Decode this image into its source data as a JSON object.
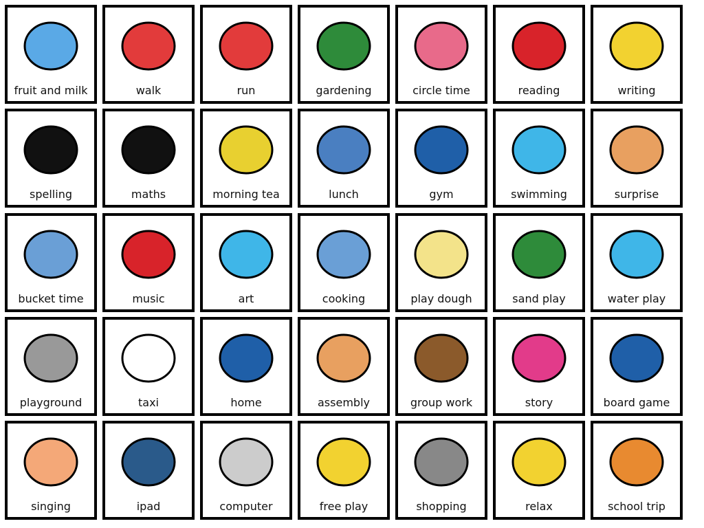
{
  "cards": [
    {
      "label": "fruit and milk",
      "icon": "milkshake-fruit-icon",
      "color": "#5aa9e6"
    },
    {
      "label": "walk",
      "icon": "walking-person-icon",
      "color": "#e23b3b"
    },
    {
      "label": "run",
      "icon": "running-person-icon",
      "color": "#e23b3b"
    },
    {
      "label": "gardening",
      "icon": "garden-tools-icon",
      "color": "#2e8b3a"
    },
    {
      "label": "circle time",
      "icon": "children-circle-icon",
      "color": "#e86a8a"
    },
    {
      "label": "reading",
      "icon": "reading-book-icon",
      "color": "#d8232a"
    },
    {
      "label": "writing",
      "icon": "writing-hand-icon",
      "color": "#f2d230"
    },
    {
      "label": "spelling",
      "icon": "abc-letters-icon",
      "color": "#111111"
    },
    {
      "label": "maths",
      "icon": "numbers-123-icon",
      "color": "#111111"
    },
    {
      "label": "morning tea",
      "icon": "sandwich-fruit-icon",
      "color": "#e8d030"
    },
    {
      "label": "lunch",
      "icon": "lunch-plate-icon",
      "color": "#4a7fc1"
    },
    {
      "label": "gym",
      "icon": "gym-equipment-icon",
      "color": "#1f5fa8"
    },
    {
      "label": "swimming",
      "icon": "swimmer-icon",
      "color": "#3fb6e8"
    },
    {
      "label": "surprise",
      "icon": "surprised-face-icon",
      "color": "#e8a060"
    },
    {
      "label": "bucket time",
      "icon": "bucket-icon",
      "color": "#6a9fd6"
    },
    {
      "label": "music",
      "icon": "instruments-icon",
      "color": "#d8232a"
    },
    {
      "label": "art",
      "icon": "art-supplies-icon",
      "color": "#3fb6e8"
    },
    {
      "label": "cooking",
      "icon": "cooking-utensils-icon",
      "color": "#6a9fd6"
    },
    {
      "label": "play dough",
      "icon": "rolling-pin-icon",
      "color": "#f3e38a"
    },
    {
      "label": "sand play",
      "icon": "sand-table-icon",
      "color": "#2e8b3a"
    },
    {
      "label": "water play",
      "icon": "water-table-icon",
      "color": "#3fb6e8"
    },
    {
      "label": "playground",
      "icon": "swing-slide-icon",
      "color": "#999999"
    },
    {
      "label": "taxi",
      "icon": "van-icon",
      "color": "#ffffff"
    },
    {
      "label": "home",
      "icon": "house-icon",
      "color": "#1f5fa8"
    },
    {
      "label": "assembly",
      "icon": "assembly-podium-icon",
      "color": "#e8a060"
    },
    {
      "label": "group work",
      "icon": "group-table-icon",
      "color": "#8b5a2b"
    },
    {
      "label": "story",
      "icon": "storybook-icon",
      "color": "#e23b8a"
    },
    {
      "label": "board game",
      "icon": "board-game-icon",
      "color": "#1f5fa8"
    },
    {
      "label": "singing",
      "icon": "singing-face-icon",
      "color": "#f4a878"
    },
    {
      "label": "ipad",
      "icon": "tablet-icon",
      "color": "#2a5a8a"
    },
    {
      "label": "computer",
      "icon": "computer-icon",
      "color": "#cccccc"
    },
    {
      "label": "free play",
      "icon": "toys-icon",
      "color": "#f2d230"
    },
    {
      "label": "shopping",
      "icon": "shopping-cart-icon",
      "color": "#888888"
    },
    {
      "label": "relax",
      "icon": "sunbathing-icon",
      "color": "#f2d230"
    },
    {
      "label": "school trip",
      "icon": "bus-road-icon",
      "color": "#e88a30"
    }
  ]
}
